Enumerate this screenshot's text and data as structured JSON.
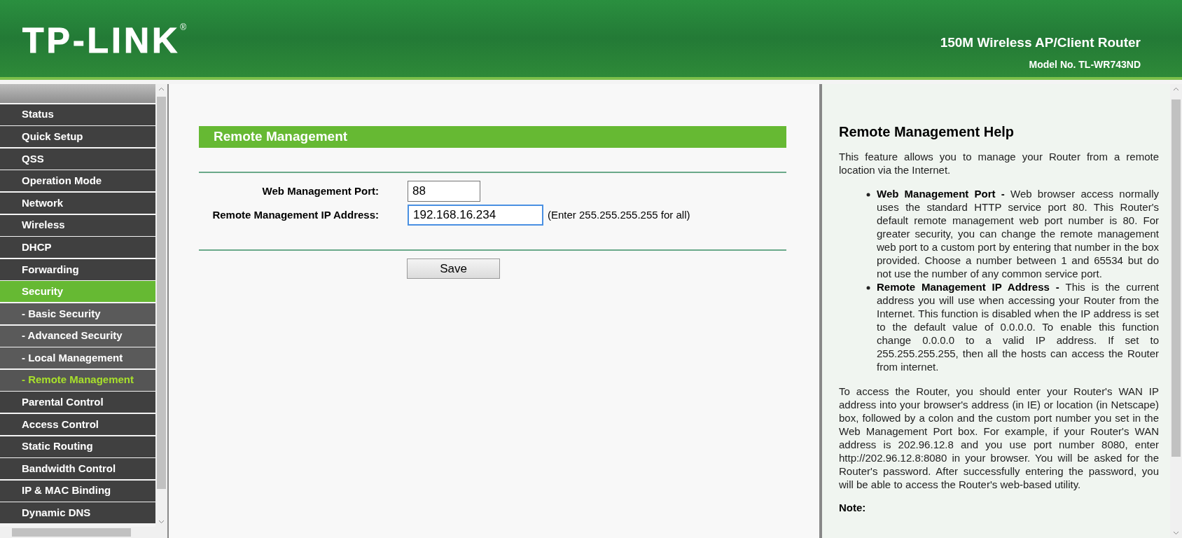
{
  "header": {
    "logo": "TP-LINK",
    "logo_mark": "®",
    "product": "150M Wireless AP/Client Router",
    "model": "Model No. TL-WR743ND"
  },
  "sidebar": {
    "items": [
      {
        "label": "Status",
        "kind": "main",
        "selected": false
      },
      {
        "label": "Quick Setup",
        "kind": "main",
        "selected": false
      },
      {
        "label": "QSS",
        "kind": "main",
        "selected": false
      },
      {
        "label": "Operation Mode",
        "kind": "main",
        "selected": false
      },
      {
        "label": "Network",
        "kind": "main",
        "selected": false
      },
      {
        "label": "Wireless",
        "kind": "main",
        "selected": false
      },
      {
        "label": "DHCP",
        "kind": "main",
        "selected": false
      },
      {
        "label": "Forwarding",
        "kind": "main",
        "selected": false
      },
      {
        "label": "Security",
        "kind": "main",
        "selected": true
      },
      {
        "label": "- Basic Security",
        "kind": "sub",
        "selected": false
      },
      {
        "label": "- Advanced Security",
        "kind": "sub",
        "selected": false
      },
      {
        "label": "- Local Management",
        "kind": "sub",
        "selected": false
      },
      {
        "label": "- Remote Management",
        "kind": "sub",
        "selected": true
      },
      {
        "label": "Parental Control",
        "kind": "main",
        "selected": false
      },
      {
        "label": "Access Control",
        "kind": "main",
        "selected": false
      },
      {
        "label": "Static Routing",
        "kind": "main",
        "selected": false
      },
      {
        "label": "Bandwidth Control",
        "kind": "main",
        "selected": false
      },
      {
        "label": "IP & MAC Binding",
        "kind": "main",
        "selected": false
      },
      {
        "label": "Dynamic DNS",
        "kind": "main",
        "selected": false
      }
    ]
  },
  "form": {
    "title": "Remote Management",
    "fields": [
      {
        "label": "Web Management Port:",
        "value": "88",
        "focused": false
      },
      {
        "label": "Remote Management IP Address:",
        "value": "192.168.16.234",
        "focused": true,
        "hint": "(Enter 255.255.255.255 for all)"
      }
    ],
    "save_button": "Save"
  },
  "help": {
    "title": "Remote Management Help",
    "intro": "This feature allows you to manage your Router from a remote location via the Internet.",
    "bullets": [
      "**Web Management Port -** Web browser access normally uses the standard HTTP service port 80. This Router's default remote management web port number is 80. For greater security, you can change the remote management web port to a custom port by entering that number in the box provided. Choose a number between 1 and 65534 but do not use the number of any common service port.",
      "**Remote Management IP Address -** This is the current address you will use when accessing your Router from the Internet. This function is disabled when the IP address is set to the default value of 0.0.0.0. To enable this function change 0.0.0.0 to a valid IP address. If set to 255.255.255.255, then all the hosts can access the Router from internet."
    ],
    "paragraph": "To access the Router, you should enter your Router's WAN IP address into your browser's address (in IE) or location (in Netscape) box, followed by a colon and the custom port number you set in the Web Management Port box. For example, if your Router's WAN address is 202.96.12.8 and you use port number 8080, enter http://202.96.12.8:8080 in your browser. You will be asked for the Router's password. After successfully entering the password, you will be able to access the Router's web-based utility.",
    "note": "Note:"
  }
}
